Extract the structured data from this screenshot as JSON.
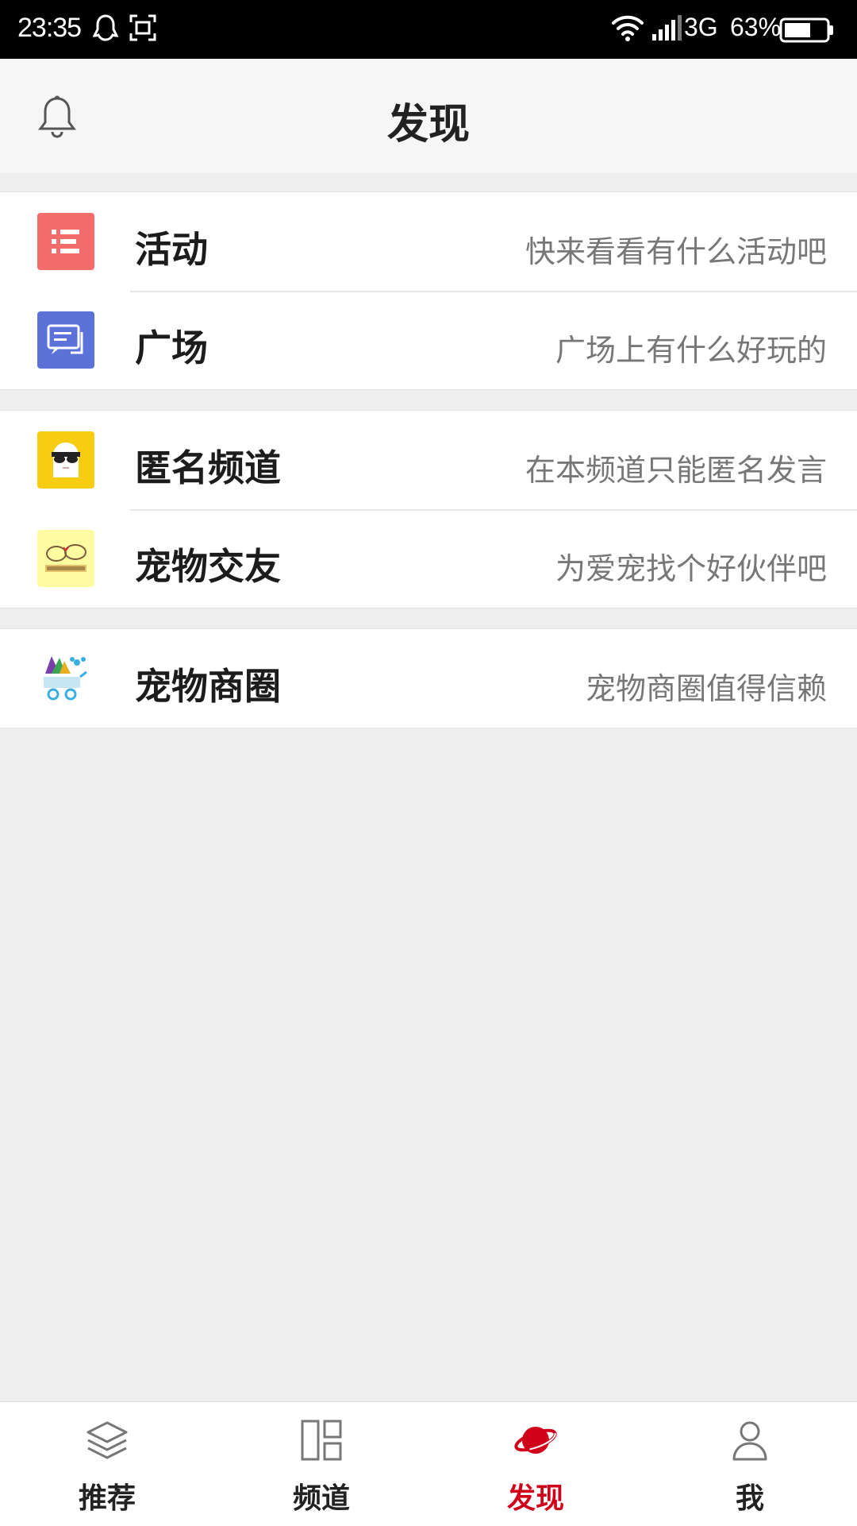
{
  "status_bar": {
    "time": "23:35",
    "network": "3G",
    "battery": "63%",
    "battery_level": 0.63
  },
  "header": {
    "title": "发现",
    "bell_icon": "bell-icon"
  },
  "groups": [
    {
      "items": [
        {
          "title": "活动",
          "desc": "快来看看有什么活动吧",
          "icon": "list-icon",
          "icon_color": "#f46b6b"
        },
        {
          "title": "广场",
          "desc": "广场上有什么好玩的",
          "icon": "chat-icon",
          "icon_color": "#5b72d8"
        }
      ]
    },
    {
      "items": [
        {
          "title": "匿名频道",
          "desc": "在本频道只能匿名发言",
          "icon": "anonymous-icon",
          "icon_color": "#f7cd12"
        },
        {
          "title": "宠物交友",
          "desc": "为爱宠找个好伙伴吧",
          "icon": "pet-friends-icon",
          "icon_color": "#fefca0"
        }
      ]
    },
    {
      "items": [
        {
          "title": "宠物商圈",
          "desc": "宠物商圈值得信赖",
          "icon": "pet-shop-icon",
          "icon_color": "#ffffff"
        }
      ]
    }
  ],
  "tabbar": {
    "active_color": "#d0021b",
    "tabs": [
      {
        "label": "推荐",
        "icon": "layers-icon"
      },
      {
        "label": "频道",
        "icon": "grid-icon"
      },
      {
        "label": "发现",
        "icon": "planet-icon",
        "active": true
      },
      {
        "label": "我",
        "icon": "person-icon"
      }
    ]
  }
}
